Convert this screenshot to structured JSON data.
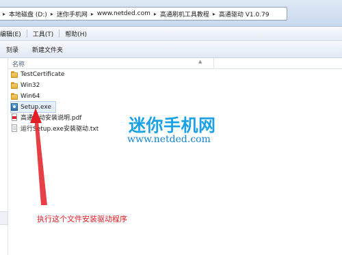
{
  "address": {
    "crumbs": [
      "本地磁盘 (D:)",
      "迷你手机网",
      "www.netded.com",
      "高通刷机工具教程",
      "高通驱动 V1.0.79"
    ]
  },
  "menu": {
    "items": [
      "编辑(E)",
      "工具(T)",
      "帮助(H)"
    ]
  },
  "commands": {
    "items": [
      "刻录",
      "新建文件夹"
    ]
  },
  "columns": {
    "name_header": "名称"
  },
  "files": [
    {
      "name": "TestCertificate",
      "icon": "folder-icon"
    },
    {
      "name": "Win32",
      "icon": "folder-icon"
    },
    {
      "name": "Win64",
      "icon": "folder-icon"
    },
    {
      "name": "Setup.exe",
      "icon": "setup-exe-icon",
      "selected": true
    },
    {
      "name": "高通驱动安装说明.pdf",
      "icon": "pdf-icon"
    },
    {
      "name": "运行Setup.exe安装驱动.txt",
      "icon": "text-file-icon"
    }
  ],
  "watermark": {
    "title": "迷你手机网",
    "url": "www.netded.com"
  },
  "annotation": {
    "text": "执行这个文件安装驱动程序",
    "color": "#e21f26"
  },
  "colors": {
    "accent": "#1aa1e6",
    "selection": "#e6f0fb"
  }
}
